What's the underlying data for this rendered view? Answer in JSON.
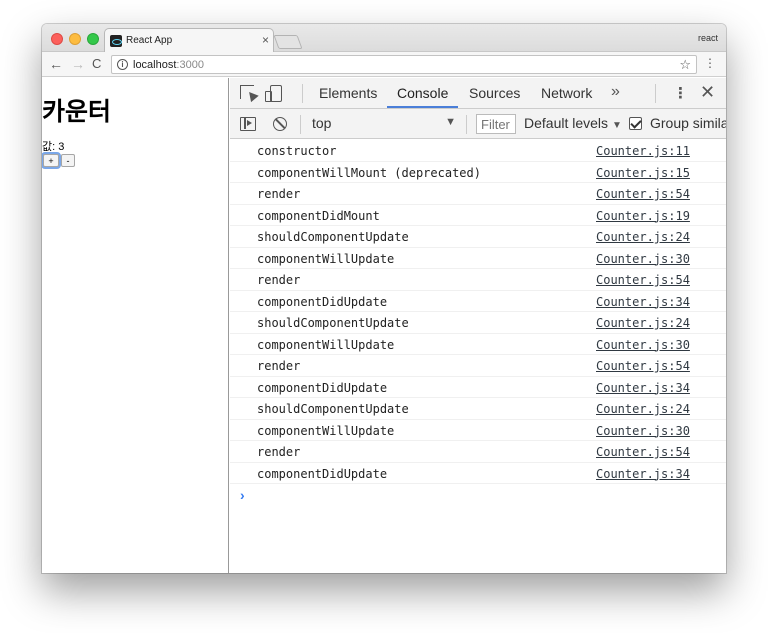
{
  "browser": {
    "tab_title": "React App",
    "tab_close": "×",
    "profile": "react",
    "url_host": "localhost",
    "url_port": ":3000",
    "icons": [
      "back-arrow-icon",
      "forward-arrow-icon",
      "reload-icon",
      "info-icon",
      "star-icon",
      "menu-dots-icon"
    ]
  },
  "page": {
    "title": "카운터",
    "value_text": "값: 3",
    "plus_label": "+",
    "minus_label": "-"
  },
  "devtools": {
    "tabs": [
      "Elements",
      "Console",
      "Sources",
      "Network"
    ],
    "active_tab": "Console",
    "more_tabs": "»",
    "context": "top",
    "filter_placeholder": "Filter",
    "levels": "Default levels",
    "group_label": "Group simila",
    "group_checked": true,
    "accent_color": "#4a7ed8"
  },
  "console_logs": [
    {
      "msg": "constructor",
      "src": "Counter.js:11"
    },
    {
      "msg": "componentWillMount (deprecated)",
      "src": "Counter.js:15"
    },
    {
      "msg": "render",
      "src": "Counter.js:54"
    },
    {
      "msg": "componentDidMount",
      "src": "Counter.js:19"
    },
    {
      "msg": "shouldComponentUpdate",
      "src": "Counter.js:24"
    },
    {
      "msg": "componentWillUpdate",
      "src": "Counter.js:30"
    },
    {
      "msg": "render",
      "src": "Counter.js:54"
    },
    {
      "msg": "componentDidUpdate",
      "src": "Counter.js:34"
    },
    {
      "msg": "shouldComponentUpdate",
      "src": "Counter.js:24"
    },
    {
      "msg": "componentWillUpdate",
      "src": "Counter.js:30"
    },
    {
      "msg": "render",
      "src": "Counter.js:54"
    },
    {
      "msg": "componentDidUpdate",
      "src": "Counter.js:34"
    },
    {
      "msg": "shouldComponentUpdate",
      "src": "Counter.js:24"
    },
    {
      "msg": "componentWillUpdate",
      "src": "Counter.js:30"
    },
    {
      "msg": "render",
      "src": "Counter.js:54"
    },
    {
      "msg": "componentDidUpdate",
      "src": "Counter.js:34"
    }
  ],
  "prompt_symbol": "›"
}
